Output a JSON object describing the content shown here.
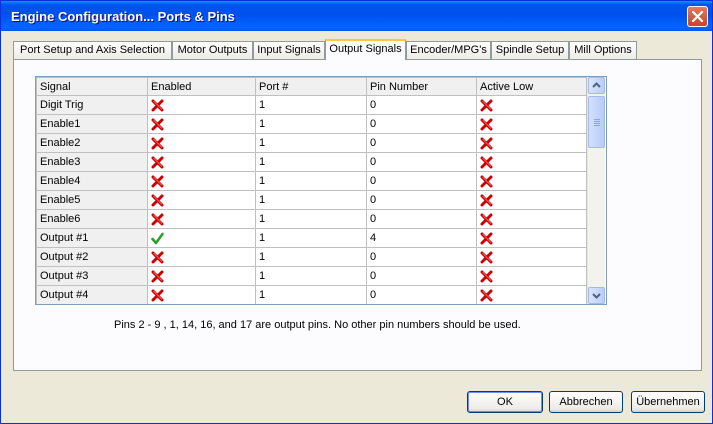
{
  "window": {
    "title": "Engine Configuration... Ports & Pins"
  },
  "tabs": [
    {
      "label": "Port Setup and Axis Selection"
    },
    {
      "label": "Motor Outputs"
    },
    {
      "label": "Input Signals"
    },
    {
      "label": "Output Signals"
    },
    {
      "label": "Encoder/MPG's"
    },
    {
      "label": "Spindle Setup"
    },
    {
      "label": "Mill Options"
    }
  ],
  "active_tab": "Output Signals",
  "table": {
    "columns": [
      "Signal",
      "Enabled",
      "Port #",
      "Pin Number",
      "Active Low"
    ],
    "rows": [
      {
        "signal": "Digit  Trig",
        "enabled": false,
        "port": "1",
        "pin": "0",
        "active_low": false
      },
      {
        "signal": "Enable1",
        "enabled": false,
        "port": "1",
        "pin": "0",
        "active_low": false
      },
      {
        "signal": "Enable2",
        "enabled": false,
        "port": "1",
        "pin": "0",
        "active_low": false
      },
      {
        "signal": "Enable3",
        "enabled": false,
        "port": "1",
        "pin": "0",
        "active_low": false
      },
      {
        "signal": "Enable4",
        "enabled": false,
        "port": "1",
        "pin": "0",
        "active_low": false
      },
      {
        "signal": "Enable5",
        "enabled": false,
        "port": "1",
        "pin": "0",
        "active_low": false
      },
      {
        "signal": "Enable6",
        "enabled": false,
        "port": "1",
        "pin": "0",
        "active_low": false
      },
      {
        "signal": "Output #1",
        "enabled": true,
        "port": "1",
        "pin": "4",
        "active_low": false
      },
      {
        "signal": "Output #2",
        "enabled": false,
        "port": "1",
        "pin": "0",
        "active_low": false
      },
      {
        "signal": "Output #3",
        "enabled": false,
        "port": "1",
        "pin": "0",
        "active_low": false
      },
      {
        "signal": "Output #4",
        "enabled": false,
        "port": "1",
        "pin": "0",
        "active_low": false
      }
    ]
  },
  "note": "Pins 2 - 9 , 1, 14, 16, and 17 are output pins. No  other pin numbers should be used.",
  "buttons": {
    "ok": "OK",
    "cancel": "Abbrechen",
    "apply": "Übernehmen"
  },
  "icons": {
    "disabled": "red-x-icon",
    "enabled": "green-check-icon"
  },
  "colors": {
    "titlebar": "#0054e3",
    "red_x": "#cc0000",
    "green_check": "#33aa33",
    "active_tab_highlight": "#ffc83c"
  }
}
